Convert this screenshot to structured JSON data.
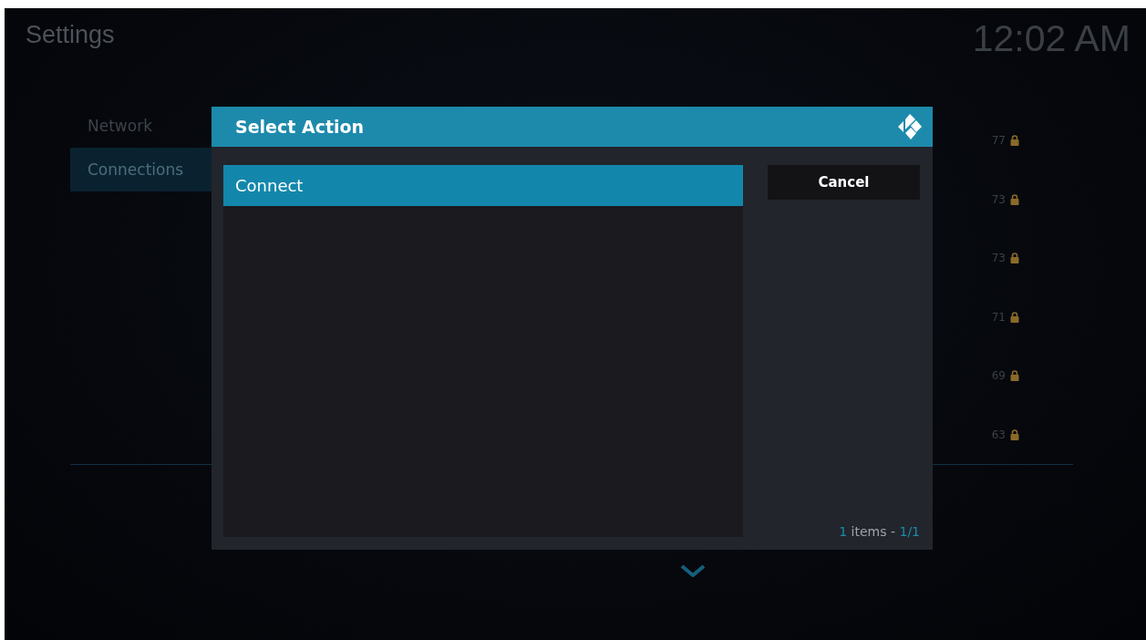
{
  "header": {
    "title": "Settings",
    "clock": "12:02 AM"
  },
  "sidebar": {
    "items": [
      {
        "label": "Network",
        "selected": false
      },
      {
        "label": "Connections",
        "selected": true
      }
    ]
  },
  "connections": [
    {
      "signal": "77",
      "secured": true
    },
    {
      "signal": "73",
      "secured": true
    },
    {
      "signal": "73",
      "secured": true
    },
    {
      "signal": "71",
      "secured": true
    },
    {
      "signal": "69",
      "secured": true
    },
    {
      "signal": "63",
      "secured": true
    }
  ],
  "dialog": {
    "title": "Select Action",
    "actions": [
      {
        "label": "Connect",
        "selected": true
      }
    ],
    "buttons": [
      {
        "label": "Cancel"
      }
    ],
    "footer": {
      "count": "1",
      "middle": " items - ",
      "page": "1/1"
    }
  }
}
